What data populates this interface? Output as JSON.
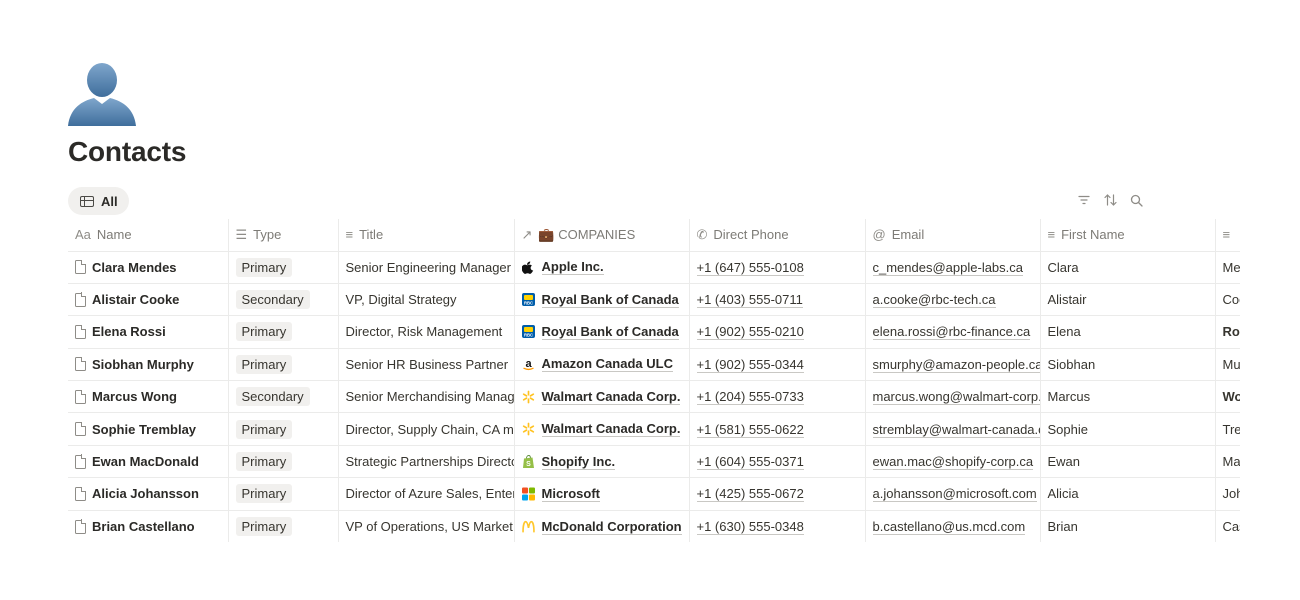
{
  "page": {
    "title": "Contacts",
    "icon": "person-silhouette-icon"
  },
  "view": {
    "tab_label": "All",
    "tab_icon": "table-icon"
  },
  "toolbar": {
    "icons": [
      "filter-icon",
      "sort-icon",
      "search-icon"
    ]
  },
  "table": {
    "columns": [
      {
        "label": "Name",
        "icon": "title-property-icon",
        "icon_text": "Aa"
      },
      {
        "label": "Type",
        "icon": "multi-select-icon",
        "icon_text": "☰"
      },
      {
        "label": "Title",
        "icon": "text-property-icon",
        "icon_text": "≡"
      },
      {
        "label": "💼 COMPANIES",
        "icon": "relation-arrow-icon",
        "icon_text": "↗"
      },
      {
        "label": "Direct Phone",
        "icon": "phone-icon",
        "icon_text": "✆"
      },
      {
        "label": "Email",
        "icon": "at-icon",
        "icon_text": "@"
      },
      {
        "label": "First Name",
        "icon": "text-property-icon",
        "icon_text": "≡"
      },
      {
        "label": "",
        "icon": "text-property-icon",
        "icon_text": "≡"
      }
    ],
    "rows": [
      {
        "name": "Clara Mendes",
        "type": "Primary",
        "title": "Senior Engineering Manager",
        "company": "Apple Inc.",
        "company_logo": "apple",
        "phone": "+1 (647) 555-0108",
        "email": "c_mendes@apple-labs.ca",
        "first_name": "Clara",
        "last_name": "Mendes",
        "last_bold": false
      },
      {
        "name": "Alistair Cooke",
        "type": "Secondary",
        "title": "VP, Digital Strategy",
        "company": "Royal Bank of Canada",
        "company_logo": "rbc",
        "phone": "+1 (403) 555-0711",
        "email": "a.cooke@rbc-tech.ca",
        "first_name": "Alistair",
        "last_name": "Cooke",
        "last_bold": false
      },
      {
        "name": "Elena Rossi",
        "type": "Primary",
        "title": "Director, Risk Management",
        "company": "Royal Bank of Canada",
        "company_logo": "rbc",
        "phone": "+1 (902) 555-0210",
        "email": "elena.rossi@rbc-finance.ca",
        "first_name": "Elena",
        "last_name": "Rossi",
        "last_bold": true
      },
      {
        "name": "Siobhan Murphy",
        "type": "Primary",
        "title": "Senior HR Business Partner",
        "company": "Amazon Canada ULC",
        "company_logo": "amazon",
        "phone": "+1 (902) 555-0344",
        "email": "smurphy@amazon-people.ca",
        "first_name": "Siobhan",
        "last_name": "Murphy",
        "last_bold": false
      },
      {
        "name": "Marcus Wong",
        "type": "Secondary",
        "title": "Senior Merchandising Manager",
        "company": "Walmart Canada Corp.",
        "company_logo": "walmart",
        "phone": "+1 (204) 555-0733",
        "email": "marcus.wong@walmart-corp.ca",
        "first_name": "Marcus",
        "last_name": "Wong",
        "last_bold": true
      },
      {
        "name": "Sophie Tremblay",
        "type": "Primary",
        "title": "Director, Supply Chain, CA market",
        "company": "Walmart Canada Corp.",
        "company_logo": "walmart",
        "phone": "+1 (581) 555-0622",
        "email": "stremblay@walmart-canada.ca",
        "first_name": "Sophie",
        "last_name": "Tremblay",
        "last_bold": false
      },
      {
        "name": "Ewan MacDonald",
        "type": "Primary",
        "title": "Strategic Partnerships Director",
        "company": "Shopify Inc.",
        "company_logo": "shopify",
        "phone": "+1 (604) 555-0371",
        "email": "ewan.mac@shopify-corp.ca",
        "first_name": "Ewan",
        "last_name": "MacDonald",
        "last_bold": false
      },
      {
        "name": "Alicia Johansson",
        "type": "Primary",
        "title": "Director of Azure Sales, Enterprise",
        "company": "Microsoft",
        "company_logo": "microsoft",
        "phone": "+1 (425) 555-0672",
        "email": "a.johansson@microsoft.com",
        "first_name": "Alicia",
        "last_name": "Johansson",
        "last_bold": false
      },
      {
        "name": "Brian Castellano",
        "type": "Primary",
        "title": "VP of Operations, US Market",
        "company": "McDonald Corporation",
        "company_logo": "mcdonalds",
        "phone": "+1 (630) 555-0348",
        "email": "b.castellano@us.mcd.com",
        "first_name": "Brian",
        "last_name": "Castellano",
        "last_bold": false
      }
    ]
  },
  "colors": {
    "badge_bg": "#f1f0ee",
    "border": "#ebebea",
    "header_text": "#7d7b76",
    "text": "#37352f"
  }
}
